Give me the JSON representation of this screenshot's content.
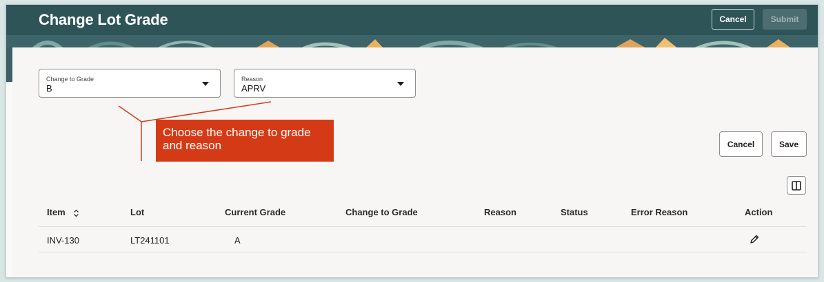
{
  "header": {
    "title": "Change Lot Grade",
    "cancel_label": "Cancel",
    "submit_label": "Submit"
  },
  "form": {
    "grade_field": {
      "label": "Change to Grade",
      "value": "B"
    },
    "reason_field": {
      "label": "Reason",
      "value": "APRV"
    }
  },
  "callout": {
    "text": "Choose the change to grade and reason"
  },
  "actions": {
    "cancel_label": "Cancel",
    "save_label": "Save"
  },
  "table": {
    "columns": [
      "Item",
      "Lot",
      "Current Grade",
      "Change to Grade",
      "Reason",
      "Status",
      "Error Reason",
      "Action"
    ],
    "rows": [
      {
        "item": "INV-130",
        "lot": "LT241101",
        "current_grade": "A",
        "change_to_grade": "",
        "reason": "",
        "status": "",
        "error_reason": ""
      }
    ]
  },
  "icons": {
    "sort": "sort-up-down-icon",
    "columns": "columns-icon",
    "edit": "pencil-icon",
    "dropdown": "chevron-down-icon"
  },
  "colors": {
    "header_bg": "#2f5457",
    "callout_bg": "#d53a16",
    "page_bg": "#f8f6f4"
  }
}
